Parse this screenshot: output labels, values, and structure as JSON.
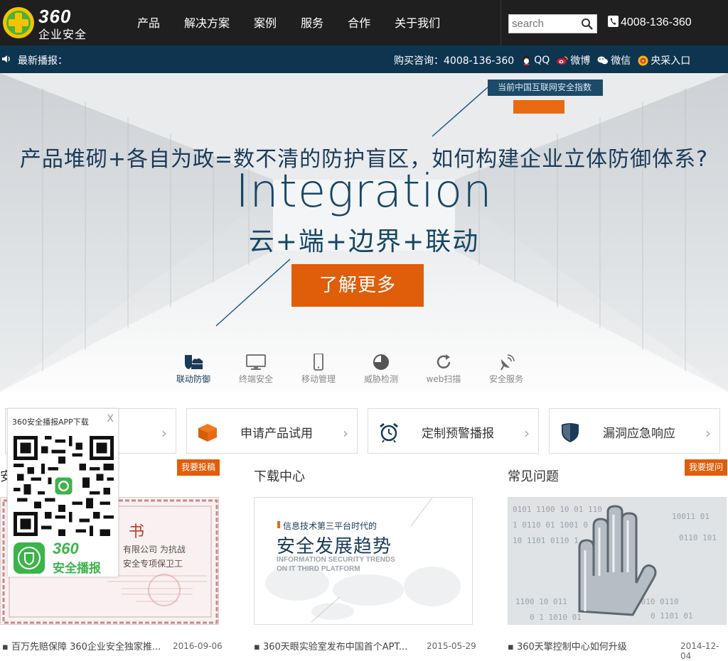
{
  "header": {
    "logo_number": "360",
    "logo_text": "企业安全",
    "nav": [
      {
        "label": "产品"
      },
      {
        "label": "解决方案"
      },
      {
        "label": "案例"
      },
      {
        "label": "服务"
      },
      {
        "label": "合作"
      },
      {
        "label": "关于我们"
      }
    ],
    "search_placeholder": "search",
    "phone": "4008-136-360"
  },
  "newsbar": {
    "label": "最新播报：",
    "consult": "购买咨询：4008-136-360",
    "qq": "QQ",
    "weibo": "微博",
    "wechat": "微信",
    "central": "央采入口"
  },
  "hero": {
    "index_label": "当前中国互联网安全指数",
    "title": "产品堆砌+各自为政=数不清的防护盲区，如何构建企业立体防御体系?",
    "word": "Integration",
    "subtitle": "云+端+边界+联动",
    "button": "了解更多",
    "features": [
      {
        "label": "联动防御",
        "icon": "linked-defense-icon"
      },
      {
        "label": "终端安全",
        "icon": "monitor-icon"
      },
      {
        "label": "移动管理",
        "icon": "mobile-icon"
      },
      {
        "label": "威胁检测",
        "icon": "threat-pie-icon"
      },
      {
        "label": "web扫描",
        "icon": "refresh-icon"
      },
      {
        "label": "安全服务",
        "icon": "satellite-icon"
      }
    ]
  },
  "qr_popup": {
    "title": "360安全播报APP下载",
    "close": "X",
    "app_number": "360",
    "app_name": "安全播报"
  },
  "cards": [
    {
      "label": "申请产品试用",
      "icon": "box-icon"
    },
    {
      "label": "定制预警播报",
      "icon": "alarm-clock-icon"
    },
    {
      "label": "漏洞应急响应",
      "icon": "shield-icon"
    }
  ],
  "columns": {
    "left": {
      "heading_fragment": "安",
      "tag": "我要投稿",
      "thumb_text_1": "书",
      "thumb_text_2": "有限公司  为抗战",
      "thumb_text_3": "安全专项保卫工",
      "item": "百万先赔保障 360企业安全独家推...",
      "date": "2016-09-06"
    },
    "middle": {
      "heading": "下载中心",
      "thumb_kicker": "信息技术第三平台时代的",
      "thumb_title": "安全发展趋势",
      "thumb_en_1": "INFORMATION SECURITY TRENDS",
      "thumb_en_2": "ON IT THIRD PLATFORM",
      "item": "360天眼实验室发布中国首个APT...",
      "date": "2015-05-29"
    },
    "right": {
      "heading": "常见问题",
      "tag": "我要提问",
      "item": "360天擎控制中心如何升级",
      "date": "2014-12-04"
    }
  },
  "colors": {
    "topbar": "#1f1f1f",
    "newsbar": "#0e3550",
    "accent_orange": "#e05d0a",
    "brand_green": "#4caf50",
    "hero_text": "#164667"
  }
}
